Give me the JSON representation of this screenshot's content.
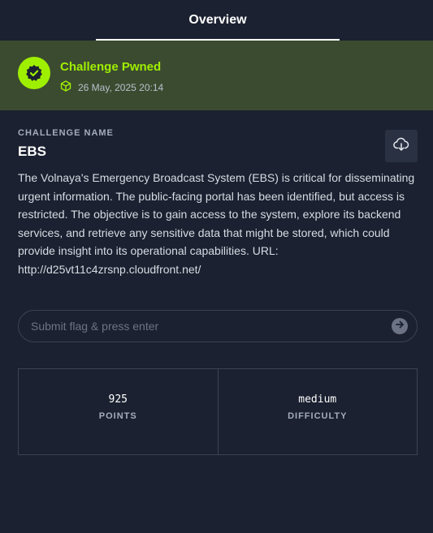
{
  "tabs": [
    {
      "label": "Overview",
      "active": true
    }
  ],
  "pwned": {
    "title": "Challenge Pwned",
    "date": "26 May, 2025 20:14",
    "badge_icon": "verified-check-icon",
    "date_icon": "cube-icon",
    "accent_color": "#9fef00"
  },
  "challenge": {
    "section_label": "CHALLENGE NAME",
    "name": "EBS",
    "download_icon": "cloud-download-icon",
    "description": "The Volnaya's Emergency Broadcast System (EBS) is critical for disseminating urgent information. The public-facing portal has been identified, but access is restricted. The objective is to gain access to the system, explore its backend services, and retrieve any sensitive data that might be stored, which could provide insight into its operational capabilities. URL: http://d25vt11c4zrsnp.cloudfront.net/"
  },
  "flag_form": {
    "placeholder": "Submit flag & press enter",
    "value": "",
    "submit_icon": "arrow-right-circle-icon"
  },
  "stats": {
    "points": {
      "value": "925",
      "label": "POINTS"
    },
    "difficulty": {
      "value": "medium",
      "label": "DIFFICULTY"
    }
  }
}
